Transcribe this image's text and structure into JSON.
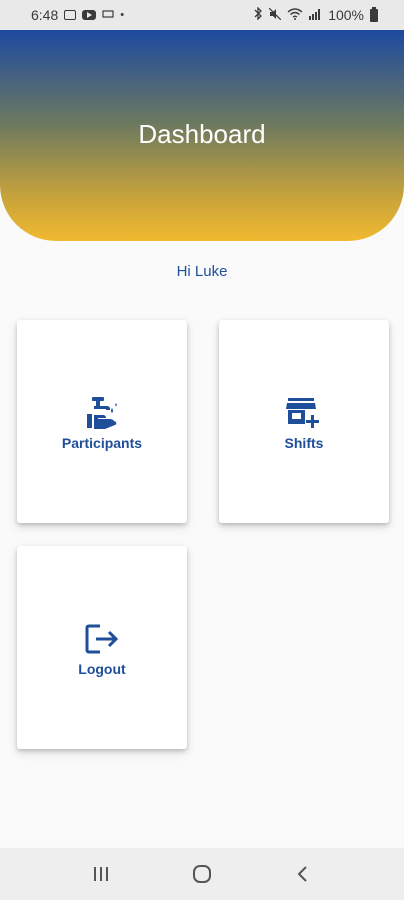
{
  "status_bar": {
    "time": "6:48",
    "dot": "•",
    "battery_text": "100%",
    "left_icons": [
      "image-icon",
      "youtube-icon",
      "message-icon"
    ],
    "right_icons": [
      "bluetooth-icon",
      "mute-icon",
      "wifi-icon",
      "signal-icon",
      "battery-icon"
    ]
  },
  "header": {
    "title": "Dashboard",
    "gradient_colors": [
      "#1d4aa0",
      "#f1b930"
    ]
  },
  "greeting": "Hi Luke",
  "cards": [
    {
      "label": "Participants",
      "icon": "hand-wash-icon"
    },
    {
      "label": "Shifts",
      "icon": "store-add-icon"
    },
    {
      "label": "Logout",
      "icon": "logout-icon"
    }
  ],
  "nav_bar": {
    "buttons": [
      "recent-apps-icon",
      "home-icon",
      "back-icon"
    ]
  },
  "colors": {
    "accent": "#1f4e9a",
    "background": "#fafafa",
    "card": "#ffffff"
  }
}
